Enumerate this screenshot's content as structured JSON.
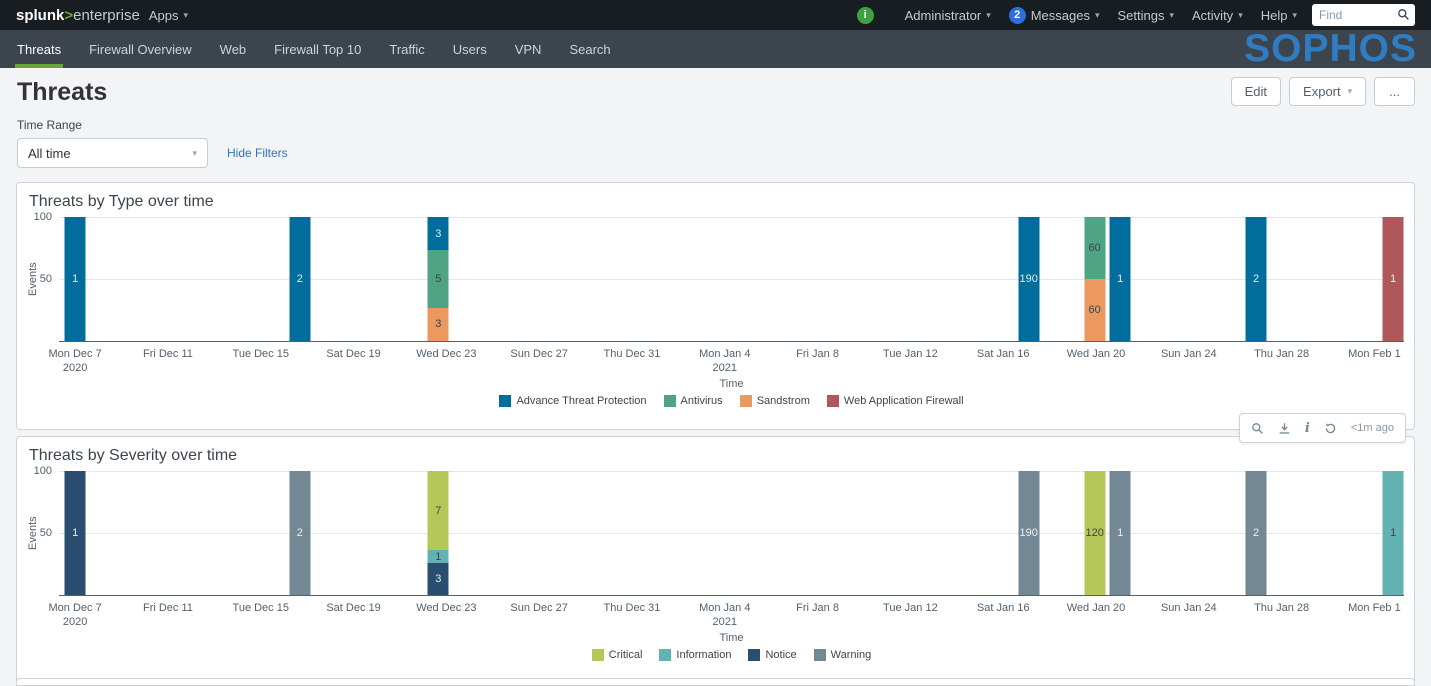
{
  "topbar": {
    "logo_splunk": "splunk",
    "logo_gt": ">",
    "logo_product": "enterprise",
    "apps_label": "Apps",
    "info_icon_glyph": "i",
    "administrator_label": "Administrator",
    "messages_count": "2",
    "messages_label": "Messages",
    "settings_label": "Settings",
    "activity_label": "Activity",
    "help_label": "Help",
    "find_placeholder": "Find"
  },
  "appbar": {
    "tabs": [
      {
        "label": "Threats",
        "active": true
      },
      {
        "label": "Firewall Overview",
        "active": false
      },
      {
        "label": "Web",
        "active": false
      },
      {
        "label": "Firewall Top 10",
        "active": false
      },
      {
        "label": "Traffic",
        "active": false
      },
      {
        "label": "Users",
        "active": false
      },
      {
        "label": "VPN",
        "active": false
      },
      {
        "label": "Search",
        "active": false
      }
    ],
    "brand": "SOPHOS"
  },
  "page": {
    "title": "Threats",
    "edit_label": "Edit",
    "export_label": "Export",
    "more_label": "...",
    "time_range_label": "Time Range",
    "time_range_value": "All time",
    "hide_filters_label": "Hide Filters"
  },
  "hover_toolbar": {
    "refreshed_label": "<1m ago"
  },
  "colors": {
    "page_bg": "#f2f4f5",
    "topbar_bg": "#171d21",
    "appbar_bg": "#3c444d",
    "nav_accent_green": "#65a637",
    "sophos_brand_blue": "#2f7cc0",
    "link_blue": "#2a72c4",
    "status_green": "#3fa142",
    "messages_badge_blue": "#2b70d9"
  },
  "chart_data": [
    {
      "type": "bar",
      "stacked": "percent",
      "title": "Threats by Type over time",
      "xlabel": "Time",
      "ylabel": "Events",
      "ylim": [
        0,
        100
      ],
      "yticks": [
        100,
        50
      ],
      "grid": "horizontal",
      "legend_position": "bottom",
      "x_ticks": [
        {
          "label": "Mon Dec 7",
          "sub": "2020"
        },
        {
          "label": "Fri Dec 11"
        },
        {
          "label": "Tue Dec 15"
        },
        {
          "label": "Sat Dec 19"
        },
        {
          "label": "Wed Dec 23"
        },
        {
          "label": "Sun Dec 27"
        },
        {
          "label": "Thu Dec 31"
        },
        {
          "label": "Mon Jan 4",
          "sub": "2021"
        },
        {
          "label": "Fri Jan 8"
        },
        {
          "label": "Tue Jan 12"
        },
        {
          "label": "Sat Jan 16"
        },
        {
          "label": "Wed Jan 20"
        },
        {
          "label": "Sun Jan 24"
        },
        {
          "label": "Thu Jan 28"
        },
        {
          "label": "Mon Feb 1"
        }
      ],
      "series": [
        {
          "name": "Advance Threat Protection",
          "color": "#006d9c"
        },
        {
          "name": "Antivirus",
          "color": "#4fa484"
        },
        {
          "name": "Sandstrom",
          "color": "#ec9960"
        },
        {
          "name": "Web Application Firewall",
          "color": "#af575a"
        }
      ],
      "bars": [
        {
          "date": "Mon Dec 7",
          "pos": 1.2,
          "segments": [
            {
              "series": "Advance Threat Protection",
              "value": 1,
              "pct": 100
            }
          ]
        },
        {
          "date": "Dec 16",
          "pos": 17.9,
          "segments": [
            {
              "series": "Advance Threat Protection",
              "value": 2,
              "pct": 100
            }
          ]
        },
        {
          "date": "Wed Dec 23",
          "pos": 28.2,
          "segments": [
            {
              "series": "Advance Threat Protection",
              "value": 3,
              "pct": 27
            },
            {
              "series": "Antivirus",
              "value": 5,
              "pct": 46
            },
            {
              "series": "Sandstrom",
              "value": 3,
              "pct": 27
            }
          ]
        },
        {
          "date": "Sat Jan 16",
          "pos": 72.1,
          "segments": [
            {
              "series": "Advance Threat Protection",
              "value": 190,
              "pct": 100
            }
          ]
        },
        {
          "date": "Wed Jan 20",
          "pos": 77.0,
          "segments": [
            {
              "series": "Antivirus",
              "value": 60,
              "pct": 50
            },
            {
              "series": "Sandstrom",
              "value": 60,
              "pct": 50
            }
          ]
        },
        {
          "date": "Jan 21",
          "pos": 78.9,
          "segments": [
            {
              "series": "Advance Threat Protection",
              "value": 1,
              "pct": 100
            }
          ]
        },
        {
          "date": "Thu Jan 28",
          "pos": 89.0,
          "segments": [
            {
              "series": "Advance Threat Protection",
              "value": 2,
              "pct": 100
            }
          ]
        },
        {
          "date": "Mon Feb 1",
          "pos": 99.2,
          "segments": [
            {
              "series": "Web Application Firewall",
              "value": 1,
              "pct": 100
            }
          ]
        }
      ]
    },
    {
      "type": "bar",
      "stacked": "percent",
      "title": "Threats by Severity over time",
      "xlabel": "Time",
      "ylabel": "Events",
      "ylim": [
        0,
        100
      ],
      "yticks": [
        100,
        50
      ],
      "grid": "horizontal",
      "legend_position": "bottom",
      "x_ticks": [
        {
          "label": "Mon Dec 7",
          "sub": "2020"
        },
        {
          "label": "Fri Dec 11"
        },
        {
          "label": "Tue Dec 15"
        },
        {
          "label": "Sat Dec 19"
        },
        {
          "label": "Wed Dec 23"
        },
        {
          "label": "Sun Dec 27"
        },
        {
          "label": "Thu Dec 31"
        },
        {
          "label": "Mon Jan 4",
          "sub": "2021"
        },
        {
          "label": "Fri Jan 8"
        },
        {
          "label": "Tue Jan 12"
        },
        {
          "label": "Sat Jan 16"
        },
        {
          "label": "Wed Jan 20"
        },
        {
          "label": "Sun Jan 24"
        },
        {
          "label": "Thu Jan 28"
        },
        {
          "label": "Mon Feb 1"
        }
      ],
      "series": [
        {
          "name": "Critical",
          "color": "#b6c75a"
        },
        {
          "name": "Information",
          "color": "#62b3b2"
        },
        {
          "name": "Notice",
          "color": "#294e70"
        },
        {
          "name": "Warning",
          "color": "#738795"
        }
      ],
      "bars": [
        {
          "date": "Mon Dec 7",
          "pos": 1.2,
          "segments": [
            {
              "series": "Notice",
              "value": 1,
              "pct": 100
            }
          ]
        },
        {
          "date": "Dec 16",
          "pos": 17.9,
          "segments": [
            {
              "series": "Warning",
              "value": 2,
              "pct": 100
            }
          ]
        },
        {
          "date": "Wed Dec 23",
          "pos": 28.2,
          "segments": [
            {
              "series": "Critical",
              "value": 7,
              "pct": 64
            },
            {
              "series": "Information",
              "value": 1,
              "pct": 10
            },
            {
              "series": "Notice",
              "value": 3,
              "pct": 26
            }
          ]
        },
        {
          "date": "Sat Jan 16",
          "pos": 72.1,
          "segments": [
            {
              "series": "Warning",
              "value": 190,
              "pct": 100
            }
          ]
        },
        {
          "date": "Wed Jan 20",
          "pos": 77.0,
          "segments": [
            {
              "series": "Critical",
              "value": 120,
              "pct": 100
            }
          ]
        },
        {
          "date": "Jan 21",
          "pos": 78.9,
          "segments": [
            {
              "series": "Warning",
              "value": 1,
              "pct": 100
            }
          ]
        },
        {
          "date": "Thu Jan 28",
          "pos": 89.0,
          "segments": [
            {
              "series": "Warning",
              "value": 2,
              "pct": 100
            }
          ]
        },
        {
          "date": "Mon Feb 1",
          "pos": 99.2,
          "segments": [
            {
              "series": "Information",
              "value": 1,
              "pct": 100
            }
          ]
        }
      ]
    }
  ]
}
